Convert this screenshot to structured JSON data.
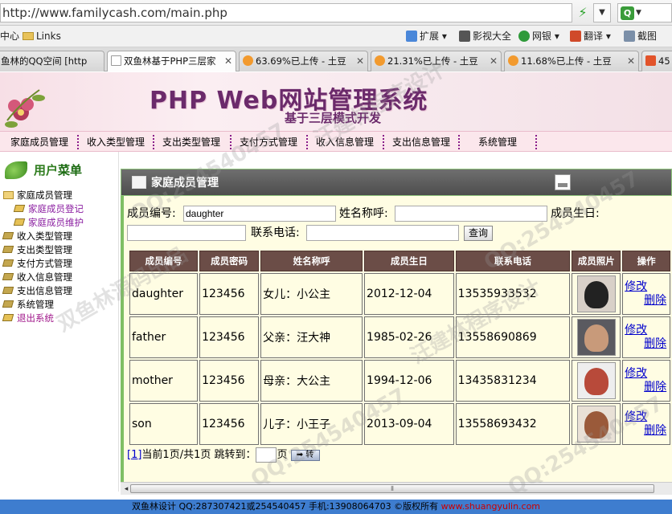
{
  "browser": {
    "url_host": "http://www.familycash.com",
    "url_path": "/main.php",
    "favorites": [
      "中心",
      "Links"
    ],
    "toolbar": [
      "扩展",
      "影视大全",
      "网银",
      "翻译",
      "截图"
    ],
    "tabs": [
      {
        "label": "鱼林的QQ空间 [http",
        "active": false
      },
      {
        "label": "双鱼林基于PHP三层家",
        "active": true
      },
      {
        "label": "63.69%已上传 - 土豆",
        "active": false
      },
      {
        "label": "21.31%已上传 - 土豆",
        "active": false
      },
      {
        "label": "11.68%已上传 - 土豆",
        "active": false
      },
      {
        "label": "45",
        "active": false
      }
    ]
  },
  "header": {
    "title": "PHP Web网站管理系统",
    "subtitle": "基于三层模式开发"
  },
  "menu": [
    "家庭成员管理",
    "收入类型管理",
    "支出类型管理",
    "支付方式管理",
    "收入信息管理",
    "支出信息管理",
    "系统管理"
  ],
  "sidebar": {
    "title_a": "用户",
    "title_b": "菜单",
    "items": [
      {
        "label": "家庭成员管理",
        "kind": "folder"
      },
      {
        "label": "家庭成员登记",
        "kind": "sub"
      },
      {
        "label": "家庭成员维护",
        "kind": "sub"
      },
      {
        "label": "收入类型管理",
        "kind": "node"
      },
      {
        "label": "支出类型管理",
        "kind": "node"
      },
      {
        "label": "支付方式管理",
        "kind": "node"
      },
      {
        "label": "收入信息管理",
        "kind": "node"
      },
      {
        "label": "支出信息管理",
        "kind": "node"
      },
      {
        "label": "系统管理",
        "kind": "node"
      },
      {
        "label": "退出系统",
        "kind": "exit"
      }
    ]
  },
  "page": {
    "title": "家庭成员管理"
  },
  "search": {
    "member_id_label": "成员编号:",
    "member_id_value": "daughter",
    "name_label": "姓名称呼:",
    "name_value": "",
    "birthday_label": "成员生日:",
    "birthday_value": "",
    "phone_label": "联系电话:",
    "phone_value": "",
    "submit_label": "查询"
  },
  "table": {
    "headers": [
      "成员编号",
      "成员密码",
      "姓名称呼",
      "成员生日",
      "联系电话",
      "成员照片",
      "操作"
    ],
    "rows": [
      {
        "id": "daughter",
        "password": "123456",
        "name": "女儿：小公主",
        "birthday": "2012-12-04",
        "phone": "13535933532",
        "edit": "修改",
        "delete": "删除"
      },
      {
        "id": "father",
        "password": "123456",
        "name": "父亲：汪大神",
        "birthday": "1985-02-26",
        "phone": "13558690869",
        "edit": "修改",
        "delete": "删除"
      },
      {
        "id": "mother",
        "password": "123456",
        "name": "母亲：大公主",
        "birthday": "1994-12-06",
        "phone": "13435831234",
        "edit": "修改",
        "delete": "删除"
      },
      {
        "id": "son",
        "password": "123456",
        "name": "儿子：小王子",
        "birthday": "2013-09-04",
        "phone": "13558693432",
        "edit": "修改",
        "delete": "删除"
      }
    ]
  },
  "pager": {
    "page_link": "[1]",
    "text": "当前1页/共1页 跳转到：",
    "unit": "页",
    "go_label": "➡ 转"
  },
  "footer": {
    "text": "双鱼林设计 QQ:287307421或254540457 手机:13908064703 ©版权所有 ",
    "url": "www.shuangyulin.com"
  },
  "watermarks": [
    "QQ:254540457",
    "汪建林程序设计",
    "双鱼林源码出品"
  ],
  "colors": {
    "menu_separator": "#8a1d8a",
    "table_header": "#6b4d47",
    "body_bg": "#fffde3",
    "footer_bg": "#3e7dcf",
    "link": "#0000cc"
  }
}
